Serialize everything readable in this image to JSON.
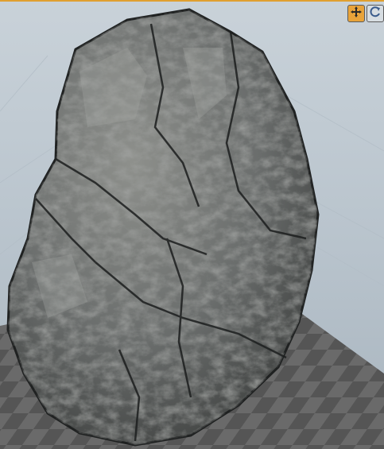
{
  "viewport": {
    "colors": {
      "frame_accent": "#e0a030",
      "sky_top": "#c9d2d9",
      "sky_bottom": "#a9b5bf",
      "floor_light": "#6b6b6b",
      "floor_dark": "#4a4a4a",
      "rock_base": "#6a6d6c",
      "rock_shadow": "#2e3030",
      "rock_highlight": "#9a9c98"
    },
    "objects": [
      {
        "name": "rock",
        "type": "mesh"
      },
      {
        "name": "ground-grid",
        "type": "grid"
      }
    ]
  },
  "nav_gizmo": {
    "buttons": [
      {
        "icon": "pan-arrows-icon",
        "active": true
      },
      {
        "icon": "orbit-icon",
        "active": false
      }
    ]
  }
}
